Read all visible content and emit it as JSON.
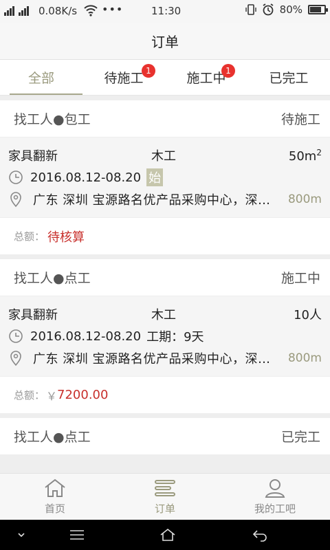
{
  "status_bar": {
    "network_small": "2G",
    "network_small_2": "4G",
    "speed": "0.08K/s",
    "dots": "•••",
    "time": "11:30",
    "battery": "80%",
    "battery_level": 0.8
  },
  "header": {
    "title": "订单"
  },
  "tabs": [
    {
      "label": "全部",
      "active": true
    },
    {
      "label": "待施工",
      "badge": "1"
    },
    {
      "label": "施工中",
      "badge": "1"
    },
    {
      "label": "已完工"
    }
  ],
  "orders": [
    {
      "type": "找工人●包工",
      "status": "待施工",
      "name": "家具翻新",
      "trade": "木工",
      "size_value": "50m",
      "size_sup": "2",
      "date": "2016.08.12-08.20",
      "extra_mark": "始",
      "address": "广东  深圳  宝源路名优产品采购中心，深圳市",
      "distance": "800m",
      "total_label": "总额：",
      "total_value": "待核算"
    },
    {
      "type": "找工人●点工",
      "status": "施工中",
      "name": "家具翻新",
      "trade": "木工",
      "size_value": "10人",
      "date": "2016.08.12-08.20",
      "period": "工期：9天",
      "address": "广东  深圳  宝源路名优产品采购中心，深圳市",
      "distance": "800m",
      "total_label": "总额：",
      "total_currency": "￥",
      "total_value": "7200.00"
    },
    {
      "type": "找工人●点工",
      "status": "已完工"
    }
  ],
  "nav": [
    {
      "label": "首页",
      "icon": "home-icon"
    },
    {
      "label": "订单",
      "icon": "order-list-icon",
      "active": true
    },
    {
      "label": "我的工吧",
      "icon": "user-icon"
    }
  ],
  "colors": {
    "accent": "#9a9a7e",
    "badge": "#e8322e",
    "price": "#c8302c"
  }
}
